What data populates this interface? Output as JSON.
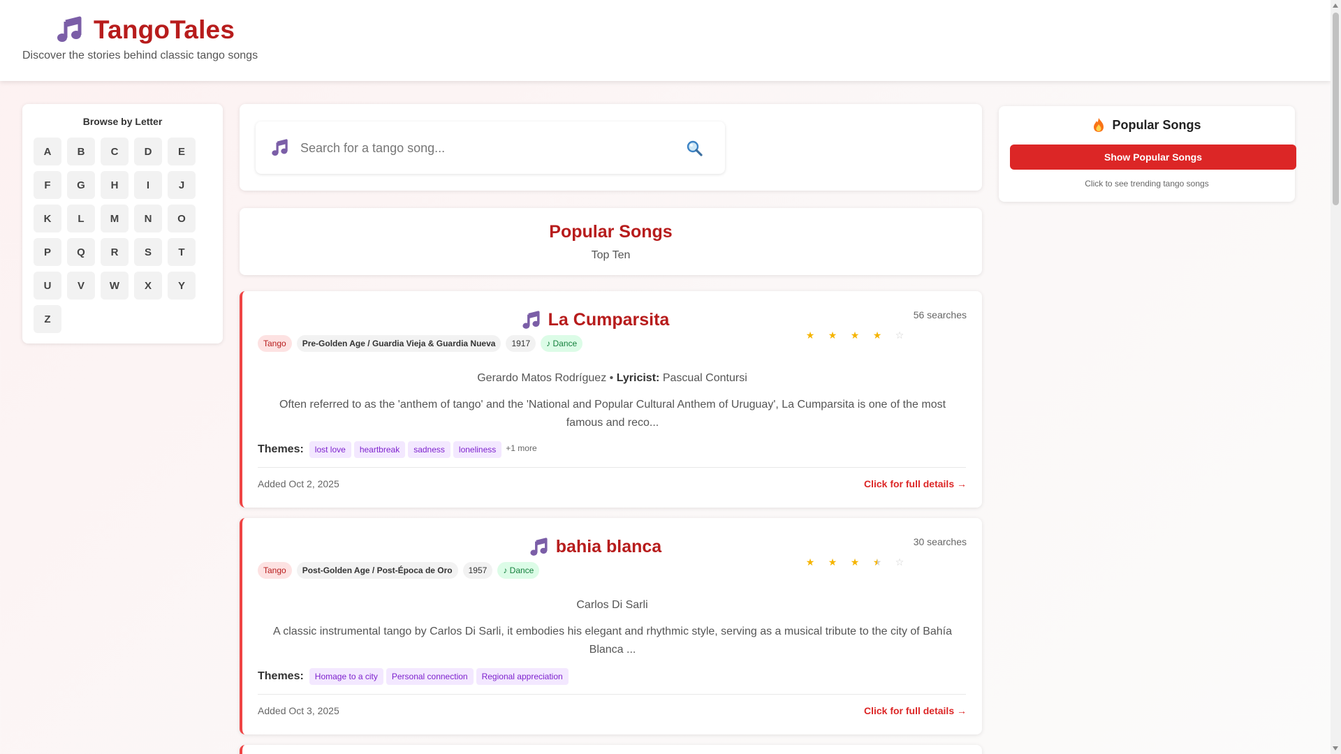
{
  "header": {
    "title": "TangoTales",
    "tagline": "Discover the stories behind classic tango songs"
  },
  "alphabet": {
    "title": "Browse by Letter",
    "letters": [
      "A",
      "B",
      "C",
      "D",
      "E",
      "F",
      "G",
      "H",
      "I",
      "J",
      "K",
      "L",
      "M",
      "N",
      "O",
      "P",
      "Q",
      "R",
      "S",
      "T",
      "U",
      "V",
      "W",
      "X",
      "Y",
      "Z"
    ]
  },
  "search": {
    "placeholder": "Search for a tango song..."
  },
  "popular": {
    "title": "Popular Songs",
    "subtitle": "Top Ten"
  },
  "sidebar": {
    "title": "Popular Songs",
    "button_label": "Show Popular Songs",
    "hint": "Click to see trending tango songs"
  },
  "songs": [
    {
      "title": "La Cumparsita",
      "searches": "56 searches",
      "rating": 4,
      "genre": "Tango",
      "era": "Pre-Golden Age / Guardia Vieja & Guardia Nueva",
      "year": "1917",
      "dance": "♪ Dance",
      "composer": "Gerardo Matos Rodríguez •",
      "lyricist_label": "Lyricist:",
      "lyricist": "Pascual Contursi",
      "description": "Often referred to as the 'anthem of tango' and the 'National and Popular Cultural Anthem of Uruguay', La Cumparsita is one of the most famous and reco...",
      "themes_label": "Themes:",
      "themes": [
        "lost love",
        "heartbreak",
        "sadness",
        "loneliness"
      ],
      "more": "+1 more",
      "added": "Added Oct 2, 2025",
      "details_label": "Click for full details →"
    },
    {
      "title": "bahia blanca",
      "searches": "30 searches",
      "rating": 3.5,
      "genre": "Tango",
      "era": "Post-Golden Age / Post-Época de Oro",
      "year": "1957",
      "dance": "♪ Dance",
      "composer": "Carlos Di Sarli",
      "description": "A classic instrumental tango by Carlos Di Sarli, it embodies his elegant and rhythmic style, serving as a musical tribute to the city of Bahía Blanca ...",
      "themes_label": "Themes:",
      "themes": [
        "Homage to a city",
        "Personal connection",
        "Regional appreciation"
      ],
      "added": "Added Oct 3, 2025",
      "details_label": "Click for full details →"
    }
  ],
  "icons": {
    "brand": "music-note-icon",
    "search_note": "music-note-icon",
    "search": "magnifier-icon",
    "fire": "fire-icon",
    "song": "music-note-icon"
  },
  "colors": {
    "brand_red": "#b71c1c",
    "accent_red": "#dc2626",
    "note_purple": "#7b5ea7",
    "star_gold": "#f5b400",
    "theme_bg": "#f3e8ff",
    "theme_text": "#7e22ce",
    "dance_bg": "#dcfce7",
    "dance_text": "#15803d"
  }
}
